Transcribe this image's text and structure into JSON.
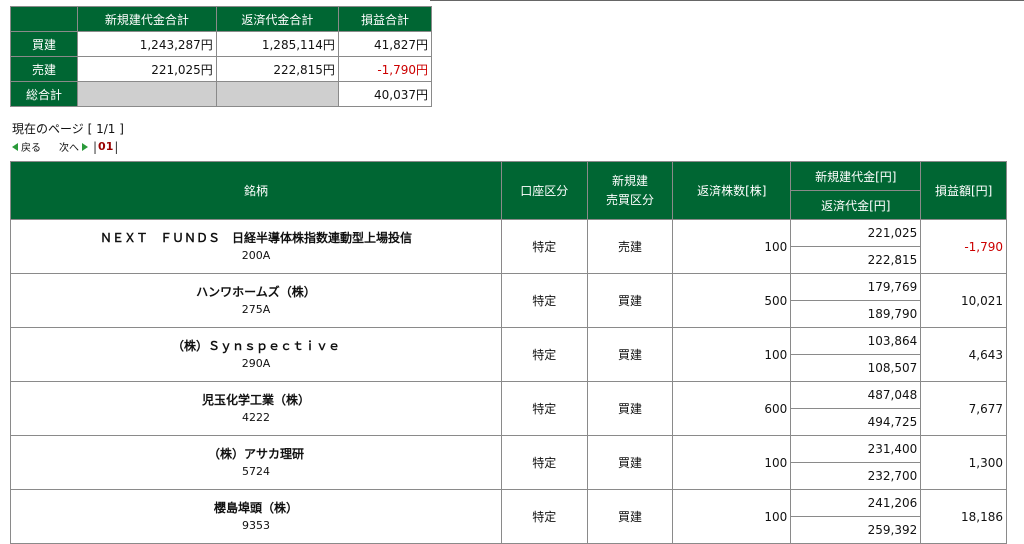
{
  "summary": {
    "headers": [
      "新規建代金合計",
      "返済代金合計",
      "損益合計"
    ],
    "rows": [
      {
        "label": "買建",
        "open": "1,243,287円",
        "close": "1,285,114円",
        "pl": "41,827円",
        "pl_neg": false
      },
      {
        "label": "売建",
        "open": "221,025円",
        "close": "222,815円",
        "pl": "-1,790円",
        "pl_neg": true
      }
    ],
    "total": {
      "label": "総合計",
      "pl": "40,037円"
    }
  },
  "page_info": "現在のページ [ 1/1 ]",
  "pager": {
    "prev": "戻る",
    "next": "次へ",
    "sep": "|",
    "current": "01"
  },
  "table": {
    "headers": {
      "name": "銘柄",
      "account": "口座区分",
      "side": "新規建\n売買区分",
      "qty": "返済株数[株]",
      "open_amt": "新規建代金[円]",
      "close_amt": "返済代金[円]",
      "pl": "損益額[円]"
    },
    "rows": [
      {
        "name": "ＮＥＸＴ　ＦＵＮＤＳ　日経半導体株指数連動型上場投信",
        "code": "200A",
        "account": "特定",
        "side": "売建",
        "qty": "100",
        "open": "221,025",
        "close": "222,815",
        "pl": "-1,790",
        "pl_neg": true
      },
      {
        "name": "ハンワホームズ（株）",
        "code": "275A",
        "account": "特定",
        "side": "買建",
        "qty": "500",
        "open": "179,769",
        "close": "189,790",
        "pl": "10,021",
        "pl_neg": false
      },
      {
        "name": "（株）Ｓｙｎｓｐｅｃｔｉｖｅ",
        "code": "290A",
        "account": "特定",
        "side": "買建",
        "qty": "100",
        "open": "103,864",
        "close": "108,507",
        "pl": "4,643",
        "pl_neg": false
      },
      {
        "name": "児玉化学工業（株）",
        "code": "4222",
        "account": "特定",
        "side": "買建",
        "qty": "600",
        "open": "487,048",
        "close": "494,725",
        "pl": "7,677",
        "pl_neg": false
      },
      {
        "name": "（株）アサカ理研",
        "code": "5724",
        "account": "特定",
        "side": "買建",
        "qty": "100",
        "open": "231,400",
        "close": "232,700",
        "pl": "1,300",
        "pl_neg": false
      },
      {
        "name": "櫻島埠頭（株）",
        "code": "9353",
        "account": "特定",
        "side": "買建",
        "qty": "100",
        "open": "241,206",
        "close": "259,392",
        "pl": "18,186",
        "pl_neg": false
      }
    ]
  },
  "colors": {
    "header_bg": "#006633",
    "negative": "#cc0000",
    "gray_cell": "#cfcfcf"
  }
}
